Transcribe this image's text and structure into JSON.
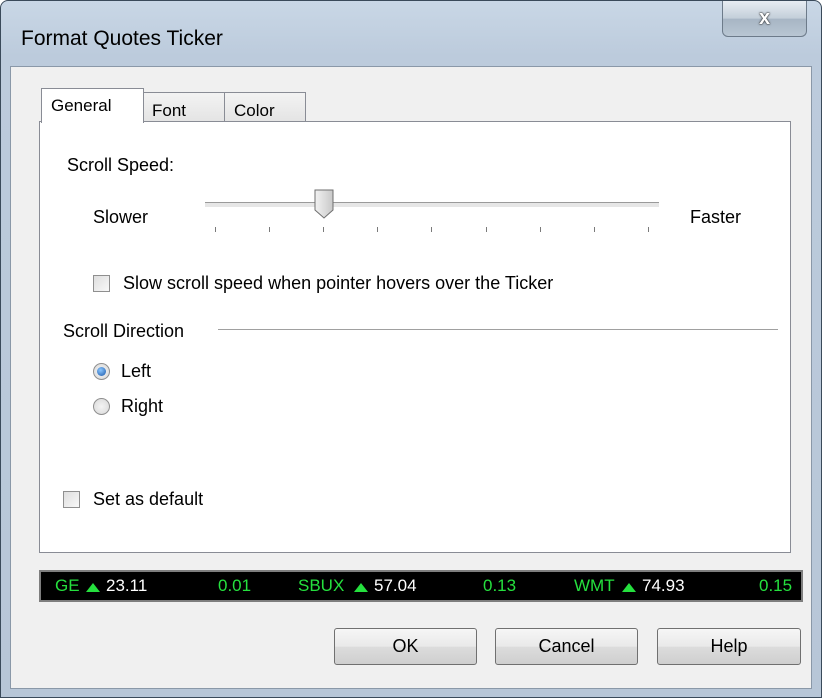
{
  "window": {
    "title": "Format Quotes Ticker",
    "close_symbol": "x"
  },
  "tabs": [
    {
      "label": "General",
      "active": true
    },
    {
      "label": "Font",
      "active": false
    },
    {
      "label": "Color",
      "active": false
    }
  ],
  "general": {
    "scroll_speed_label": "Scroll Speed:",
    "slower_label": "Slower",
    "faster_label": "Faster",
    "speed_value": 0.25,
    "slow_on_hover_label": "Slow scroll speed when pointer hovers over the Ticker",
    "slow_on_hover_checked": false,
    "scroll_direction_label": "Scroll Direction",
    "direction_options": [
      {
        "label": "Left",
        "selected": true
      },
      {
        "label": "Right",
        "selected": false
      }
    ],
    "set_default_label": "Set as default",
    "set_default_checked": false
  },
  "ticker": [
    {
      "symbol": "GE",
      "price": "23.11",
      "change": "0.01"
    },
    {
      "symbol": "SBUX",
      "price": "57.04",
      "change": "0.13"
    },
    {
      "symbol": "WMT",
      "price": "74.93",
      "change": "0.15"
    }
  ],
  "buttons": {
    "ok": "OK",
    "cancel": "Cancel",
    "help": "Help"
  },
  "colors": {
    "ticker_up": "#25e03e",
    "ticker_background": "#000000"
  }
}
